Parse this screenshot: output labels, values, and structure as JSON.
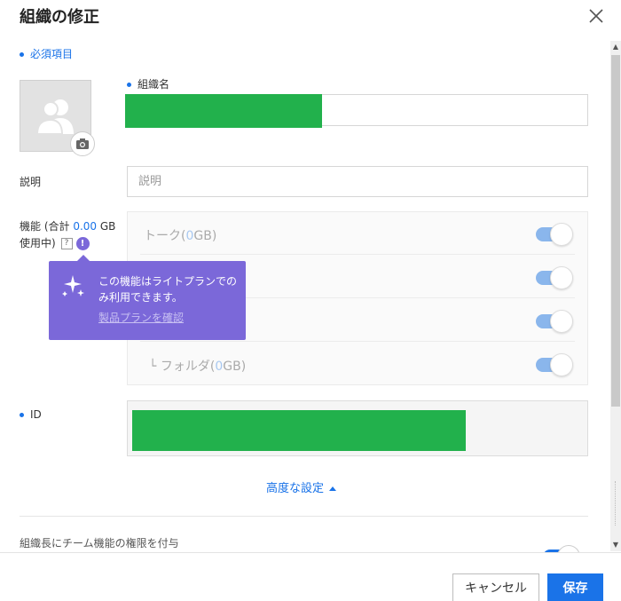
{
  "dialog": {
    "title": "組織の修正",
    "required_note": "必須項目"
  },
  "form": {
    "org_name_label": "組織名",
    "description_label": "説明",
    "description_placeholder": "説明",
    "features_label_prefix": "機能 (合計 ",
    "features_total": "0.00",
    "features_label_suffix": " GB",
    "features_label_line2": "使用中)",
    "help_icon_text": "?",
    "warning_icon_text": "!",
    "id_label": "ID",
    "advanced_settings": "高度な設定",
    "team_permission_label": "組織長にチーム機能の権限を付与"
  },
  "features": [
    {
      "name": "トーク(",
      "size": "0",
      "unit": "GB)",
      "enabled": true
    },
    {
      "name": "",
      "size": "",
      "unit": "",
      "enabled": true
    },
    {
      "name": "",
      "size": "",
      "unit": "",
      "enabled": true
    },
    {
      "name": "└  フォルダ(",
      "size": "0",
      "unit": "GB)",
      "enabled": true
    }
  ],
  "tooltip": {
    "text": "この機能はライトプランでのみ利用できます。",
    "link": "製品プランを確認"
  },
  "footer": {
    "cancel_label": "キャンセル",
    "save_label": "保存"
  },
  "colors": {
    "accent": "#1a73e8",
    "tooltip_bg": "#7b68d9",
    "redaction": "#22b14c"
  }
}
